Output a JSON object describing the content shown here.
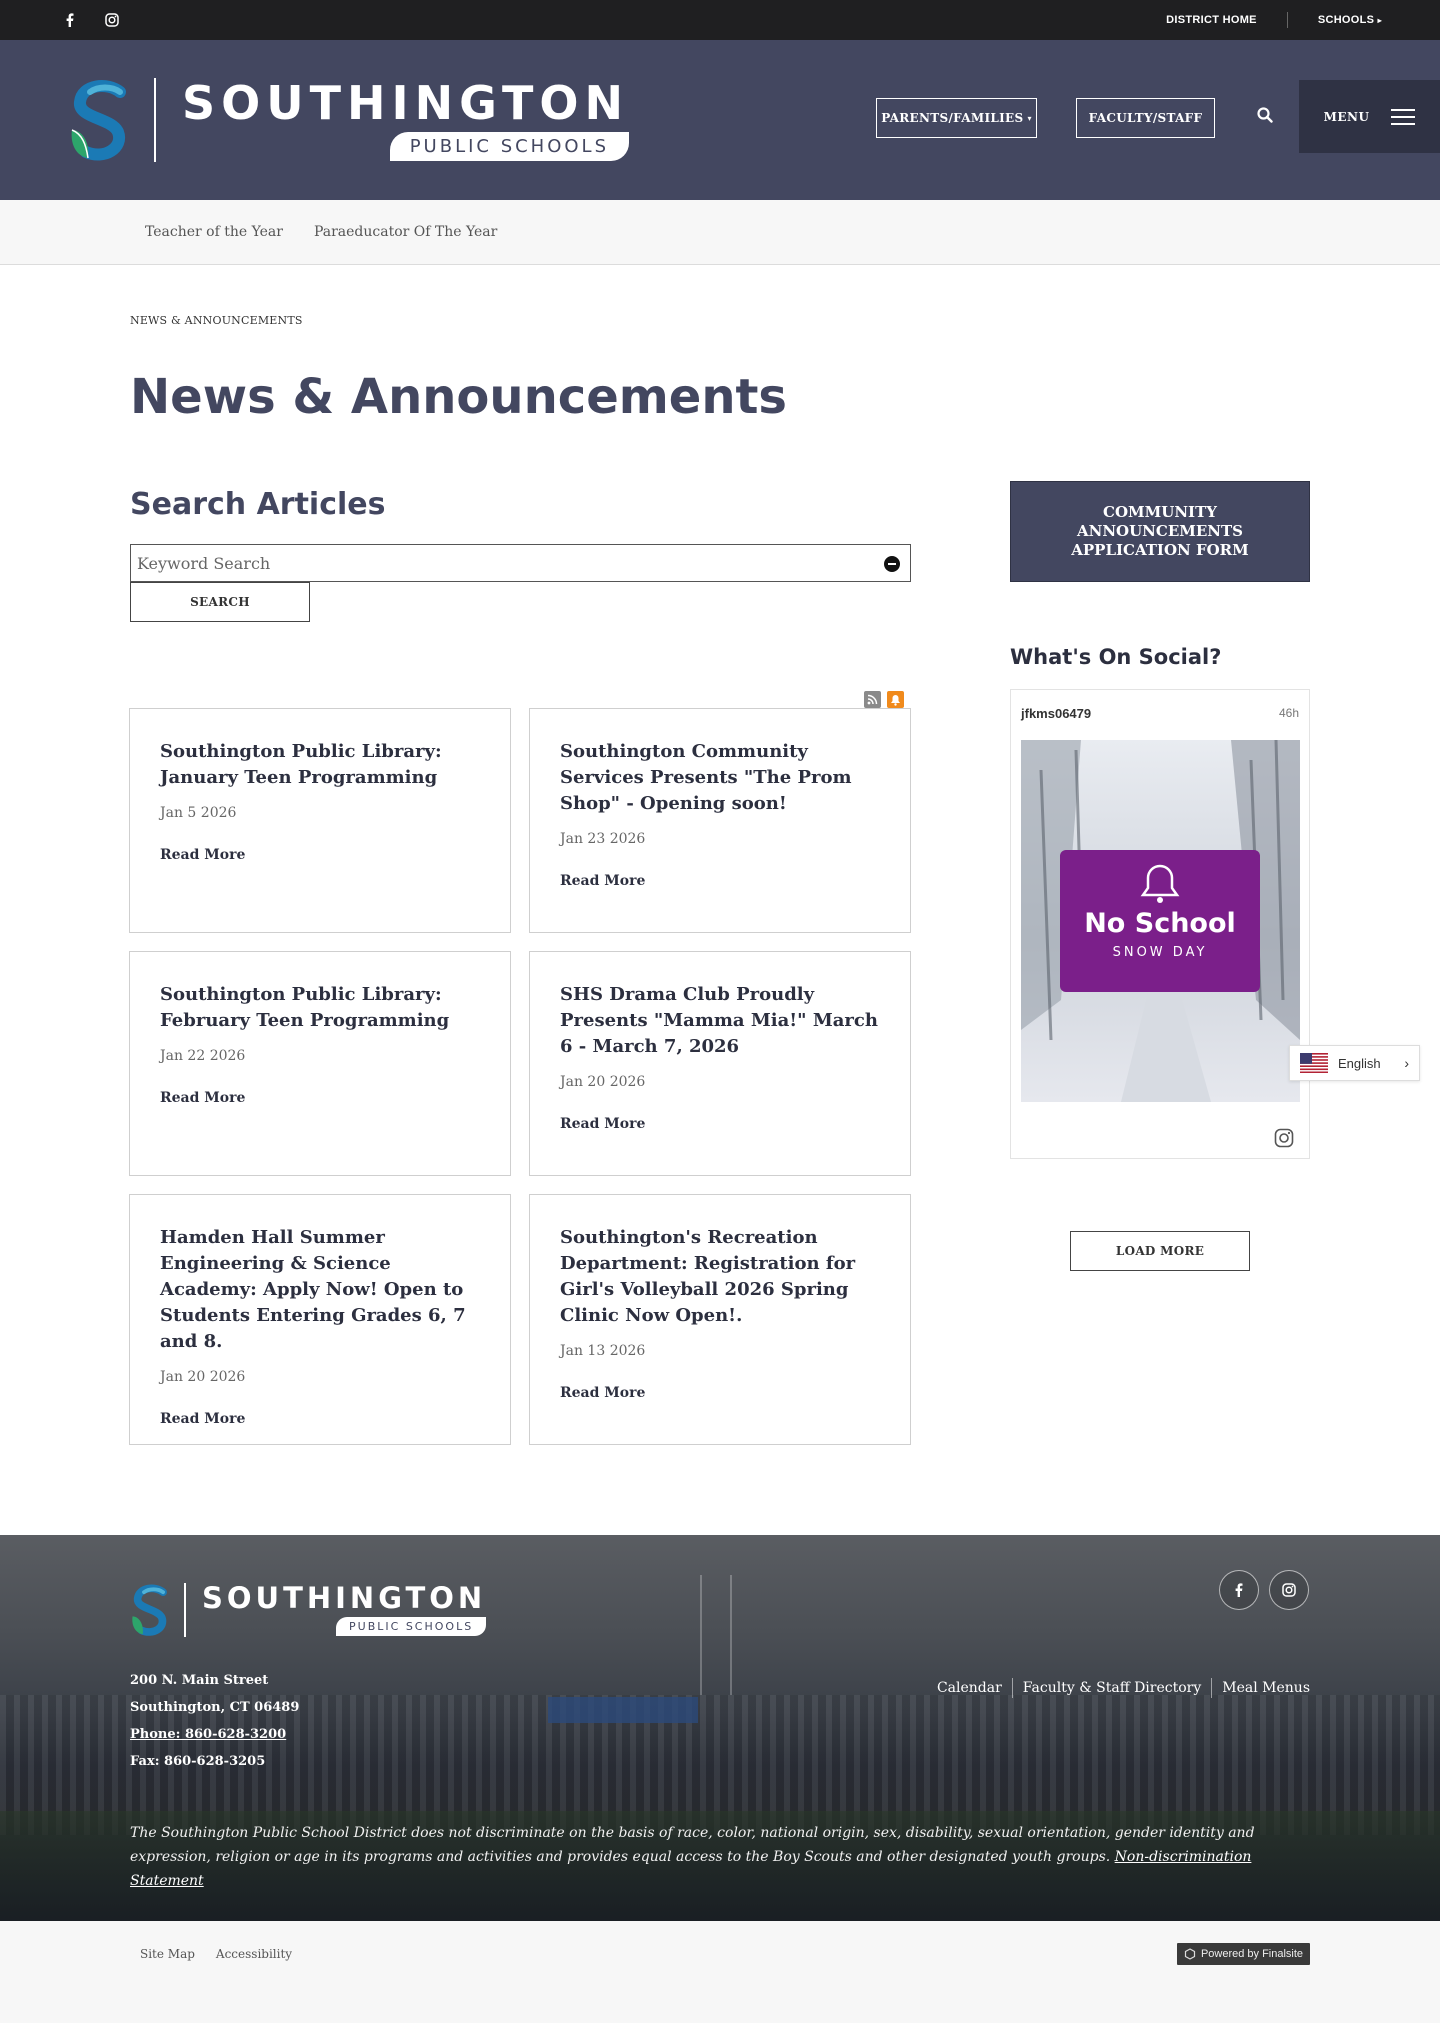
{
  "topbar": {
    "social_icons": [
      "facebook-icon",
      "instagram-icon"
    ],
    "district_home": "DISTRICT HOME",
    "schools": "SCHOOLS"
  },
  "header": {
    "logo_big": "SOUTHINGTON",
    "logo_small": "PUBLIC SCHOOLS",
    "parents_families": "PARENTS/FAMILIES",
    "faculty_staff": "FACULTY/STAFF",
    "menu": "MENU"
  },
  "subnav": {
    "items": [
      "Teacher of the Year",
      "Paraeducator Of The Year"
    ]
  },
  "breadcrumb": "NEWS & ANNOUNCEMENTS",
  "page_title": "News & Announcements",
  "search": {
    "title": "Search Articles",
    "placeholder": "Keyword Search",
    "button": "SEARCH"
  },
  "articles": [
    {
      "title": "Southington Public Library: January Teen Programming",
      "date": "Jan 5 2026",
      "link": "Read More"
    },
    {
      "title": "Southington Community Services Presents \"The Prom Shop\" - Opening soon!",
      "date": "Jan 23 2026",
      "link": "Read More"
    },
    {
      "title": "Southington Public Library: February Teen Programming",
      "date": "Jan 22 2026",
      "link": "Read More"
    },
    {
      "title": "SHS Drama Club Proudly Presents \"Mamma Mia!\" March 6 - March 7, 2026",
      "date": "Jan 20 2026",
      "link": "Read More"
    },
    {
      "title": "Hamden Hall Summer Engineering & Science Academy: Apply Now! Open to Students Entering Grades 6, 7 and 8.",
      "date": "Jan 20 2026",
      "link": "Read More"
    },
    {
      "title": "Southington's Recreation Department: Registration for Girl's Volleyball 2026 Spring Clinic Now Open!.",
      "date": "Jan 13 2026",
      "link": "Read More"
    }
  ],
  "sidebar": {
    "cta": "COMMUNITY ANNOUNCEMENTS APPLICATION FORM",
    "social_title": "What's On Social?",
    "post_user": "jfkms06479",
    "post_age": "46h",
    "post_image_headline": "No School",
    "post_image_sub": "SNOW DAY",
    "load_more": "LOAD MORE"
  },
  "language": {
    "current": "English"
  },
  "footer": {
    "logo_big": "SOUTHINGTON",
    "logo_small": "PUBLIC SCHOOLS",
    "address_line1": "200 N. Main Street",
    "address_line2": "Southington, CT  06489",
    "phone": "Phone: 860-628-3200",
    "fax": "Fax: 860-628-3205",
    "links": [
      "Calendar",
      "Faculty & Staff Directory",
      "Meal Menus"
    ],
    "nondiscrimination_text": "The Southington Public School District does not discriminate on the basis of race, color, national origin, sex, disability, sexual orientation, gender identity and expression, religion or age in its programs and activities and provides equal access to the Boy Scouts and other designated youth groups.",
    "nondiscrimination_link": "Non-discrimination Statement"
  },
  "bottom": {
    "site_map": "Site Map",
    "accessibility": "Accessibility",
    "powered": "Powered by Finalsite"
  },
  "colors": {
    "brand_navy": "#434760",
    "menu_dark": "#2f3244",
    "topbar": "#1f1f21",
    "rss_orange": "#f08a1c",
    "post_purple": "#7b1f8a"
  }
}
